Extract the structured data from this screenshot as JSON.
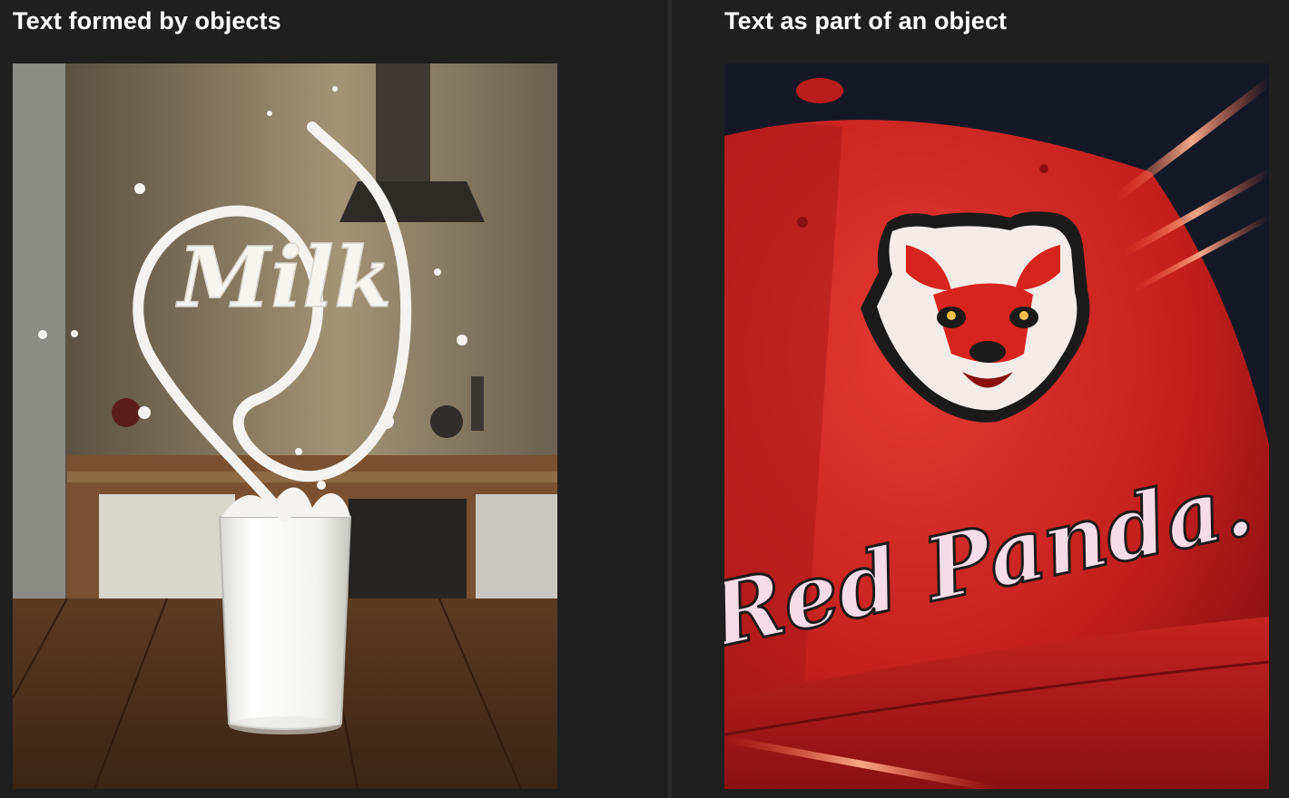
{
  "panels": [
    {
      "title": "Text formed by objects",
      "image": {
        "word": "Milk"
      }
    },
    {
      "title": "Text as part of an object",
      "image": {
        "word": "Red Panda."
      }
    }
  ]
}
